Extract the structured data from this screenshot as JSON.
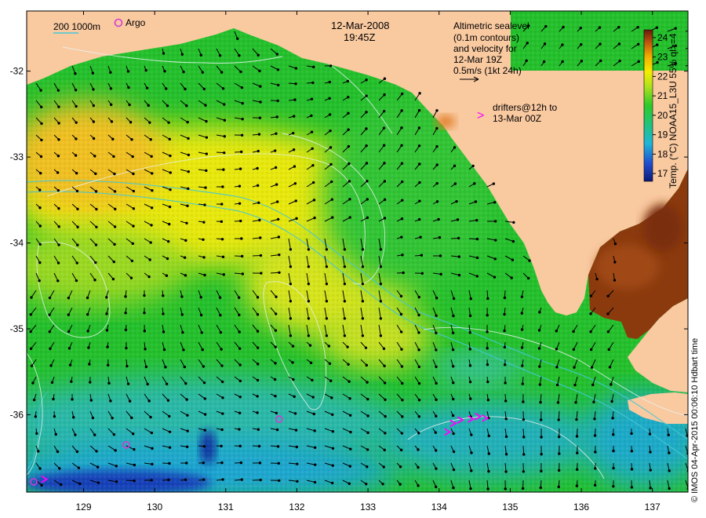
{
  "title": {
    "date": "12-Mar-2008",
    "time": "19:45Z"
  },
  "bathymetry_legend": "200 1000m",
  "argo_legend": "Argo",
  "altimetry_note": [
    "Altimetric sealevel",
    "(0.1m contours)",
    "and velocity for",
    "12-Mar 19Z",
    "0.5m/s (1kt 24h)"
  ],
  "drifter_note": [
    "drifters@12h to",
    "13-Mar 00Z"
  ],
  "drifter_symbol": ">",
  "colorbar": {
    "label": "Temp. (°C) NOAA15_L3U 55% ql>=4",
    "ticks": [
      "17",
      "18",
      "19",
      "20",
      "21",
      "22",
      "23",
      "24"
    ],
    "min": 16.6,
    "max": 24.4
  },
  "axes": {
    "lon_ticks": [
      "129",
      "130",
      "131",
      "132",
      "133",
      "134",
      "135",
      "136",
      "137"
    ],
    "lat_ticks": [
      "-32",
      "-33",
      "-34",
      "-35",
      "-36"
    ],
    "lon_range": [
      128.2,
      137.5
    ],
    "lat_range": [
      -31.3,
      -36.9
    ]
  },
  "credit": "© IMOS 04-Apr-2015 00:06:10 Hdbart time",
  "colors": {
    "land": "#f9c9a0",
    "ocean_warm": "#f2e400",
    "ocean_mid": "#22c22a",
    "ocean_cool": "#1fa9c7",
    "ocean_cold": "#1030a0",
    "gulf_hot": "#8b3a0e",
    "argo": "#d23cd6",
    "drifter": "#ff00ff",
    "contour": "#e8f3f0",
    "isobath": "#44c7d6"
  },
  "argo_floats": [
    [
      129.6,
      -36.35
    ],
    [
      131.75,
      -36.05
    ],
    [
      128.3,
      -36.78
    ]
  ],
  "drifters": [
    [
      134.2,
      -36.1
    ],
    [
      134.3,
      -36.06
    ],
    [
      134.45,
      -36.05
    ],
    [
      134.55,
      -36.02
    ],
    [
      134.65,
      -36.04
    ],
    [
      134.12,
      -36.2
    ],
    [
      128.45,
      -36.75
    ]
  ]
}
